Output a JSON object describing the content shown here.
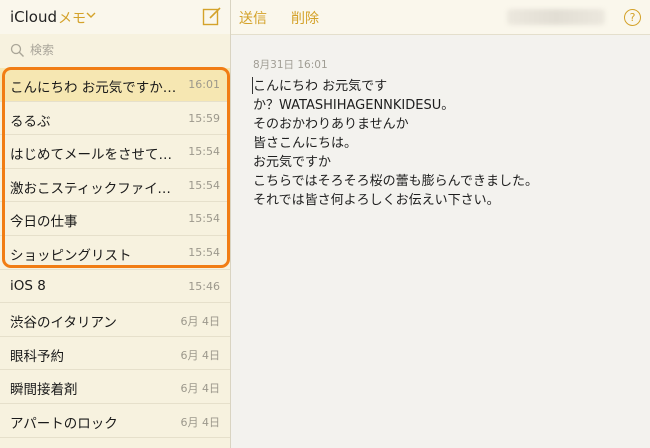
{
  "sidebar": {
    "app_title": "iCloud",
    "app_subtitle": "メモ",
    "search_placeholder": "検索",
    "notes": [
      {
        "title": "こんにちわ お元気ですか…",
        "time": "16:01",
        "selected": true
      },
      {
        "title": "るるぶ",
        "time": "15:59"
      },
      {
        "title": "はじめてメールをさせて頂…",
        "time": "15:54"
      },
      {
        "title": "激おこスティックファイナリア…",
        "time": "15:54"
      },
      {
        "title": "今日の仕事",
        "time": "15:54"
      },
      {
        "title": "ショッピングリスト",
        "time": "15:54"
      },
      {
        "title": "iOS 8",
        "time": "15:46"
      },
      {
        "title": "渋谷のイタリアン",
        "time": "6月 4日"
      },
      {
        "title": "眼科予約",
        "time": "6月 4日"
      },
      {
        "title": "瞬間接着剤",
        "time": "6月 4日"
      },
      {
        "title": "アパートのロック",
        "time": "6月 4日"
      }
    ]
  },
  "toolbar": {
    "send_label": "送信",
    "delete_label": "削除",
    "help_label": "?"
  },
  "note": {
    "date": "8月31日 16:01",
    "lines": [
      "こんにちわ お元気です",
      "か？WATASHIHAGENNKIDESU。",
      "そのおかわりありませんか",
      "皆さこんにちは。",
      "お元気ですか",
      "こちらではそろそろ桜の蕾も膨らんできました。",
      "それでは皆さ何よろしくお伝えい下さい。"
    ]
  },
  "colors": {
    "accent": "#d4a22a",
    "highlight_border": "#f17d14",
    "sidebar_bg": "#f7f2df",
    "selected_bg": "#f6e7b2"
  },
  "icons": {
    "dropdown": "chevron-down-icon",
    "compose": "compose-icon",
    "search": "search-icon",
    "help": "help-icon"
  }
}
